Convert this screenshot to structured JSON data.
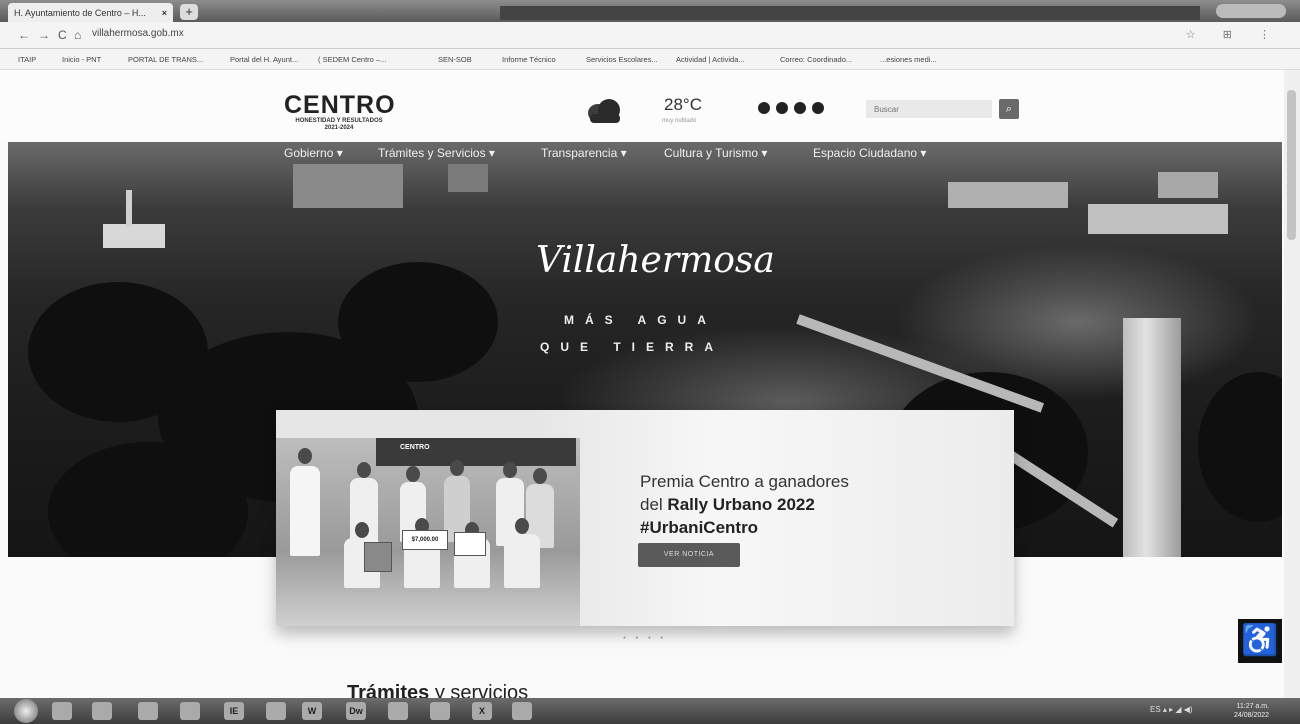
{
  "browser": {
    "tab_title": "H. Ayuntamiento de Centro – H...",
    "tab_close": "×",
    "new_tab": "+",
    "url": "villahermosa.gob.mx",
    "nav": {
      "back": "←",
      "forward": "→",
      "reload": "C",
      "home": "⌂"
    },
    "bookmarks": [
      "ITAIP",
      "Inicio - PNT",
      "PORTAL DE TRANS...",
      "Portal del H. Ayunt...",
      "( SEDEM Centro –...",
      "SEN-SOB",
      "Informe Técnico",
      "Servicios Escolares...",
      "Actividad | Activida...",
      "Correo: Coordinado...",
      "...esiones medi..."
    ]
  },
  "site": {
    "logo": {
      "name": "CENTRO",
      "tagline": "HONESTIDAD Y RESULTADOS",
      "years": "2021-2024"
    },
    "weather": {
      "temperature": "28°C",
      "condition": "muy nublado",
      "icon": "cloud-icon"
    },
    "social": [
      "facebook-icon",
      "twitter-icon",
      "instagram-icon",
      "youtube-icon"
    ],
    "search": {
      "placeholder": "Buscar"
    },
    "menu": [
      "Gobierno ▾",
      "Trámites y Servicios ▾",
      "Transparencia ▾",
      "Cultura y Turismo ▾",
      "Espacio Ciudadano ▾"
    ]
  },
  "hero": {
    "brand": "Villahermosa",
    "tagline_line1": "MÁS AGUA",
    "tagline_line2": "QUE TIERRA"
  },
  "news": {
    "title_line1": "Premia Centro a ganadores",
    "title_line2_prefix": "del ",
    "title_line2_bold": "Rally Urbano 2022",
    "title_line3": "#UrbaniCentro",
    "button": "VER NOTICIA",
    "photo_banner": "CENTRO",
    "photo_sign": "$7,000.00"
  },
  "section": {
    "title_bold": "Trámites",
    "title_rest": " y servicios"
  },
  "taskbar": {
    "apps": [
      "IE",
      "W",
      "Dw",
      "X"
    ],
    "tray": "ES  ▴  ▸ ◢ ◀)",
    "clock_time": "11:27 a.m.",
    "clock_date": "24/08/2022"
  },
  "colors": {
    "hero_dark": "#1b1b1b",
    "button": "#5a5a5a",
    "accessibility": "#111111"
  }
}
